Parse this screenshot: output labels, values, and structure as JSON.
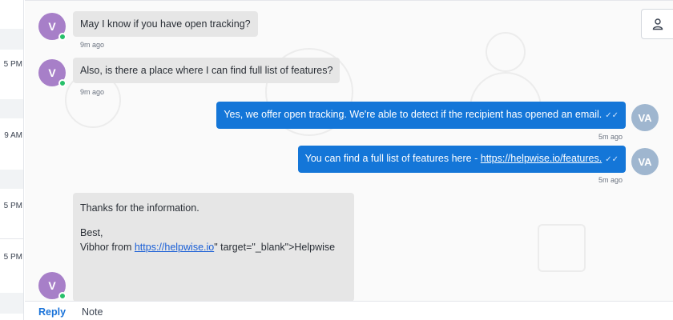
{
  "sidebar": {
    "times": [
      "5 PM",
      "9 AM",
      "5 PM",
      "5 PM"
    ]
  },
  "chat": {
    "messages": [
      {
        "avatar": "V",
        "text": "May I know if you have open tracking?",
        "time": "9m ago"
      },
      {
        "avatar": "V",
        "text": "Also, is there a place where I can find full list of features?",
        "time": "9m ago"
      },
      {
        "avatar": "VA",
        "text": "Yes, we offer open tracking. We're able to detect if the recipient has opened an email.",
        "time": "5m ago"
      },
      {
        "avatar": "VA",
        "text_prefix": "You can find a full list of features here - ",
        "link": "https://helpwise.io/features.",
        "time": "5m ago"
      },
      {
        "avatar": "V",
        "line1": "Thanks for the information.",
        "line2": "Best,",
        "line3_prefix": "Vibhor from ",
        "line3_link": "https://helpwise.io",
        "line3_suffix": "\" target=\"_blank\">Helpwise"
      }
    ],
    "read_ticks": "✓✓"
  },
  "footer": {
    "tabs": [
      "Reply",
      "Note"
    ]
  },
  "colors": {
    "outgoing": "#1476d8",
    "incoming": "#e6e6e6",
    "accent": "#1a73d9",
    "online": "#27c06a"
  }
}
